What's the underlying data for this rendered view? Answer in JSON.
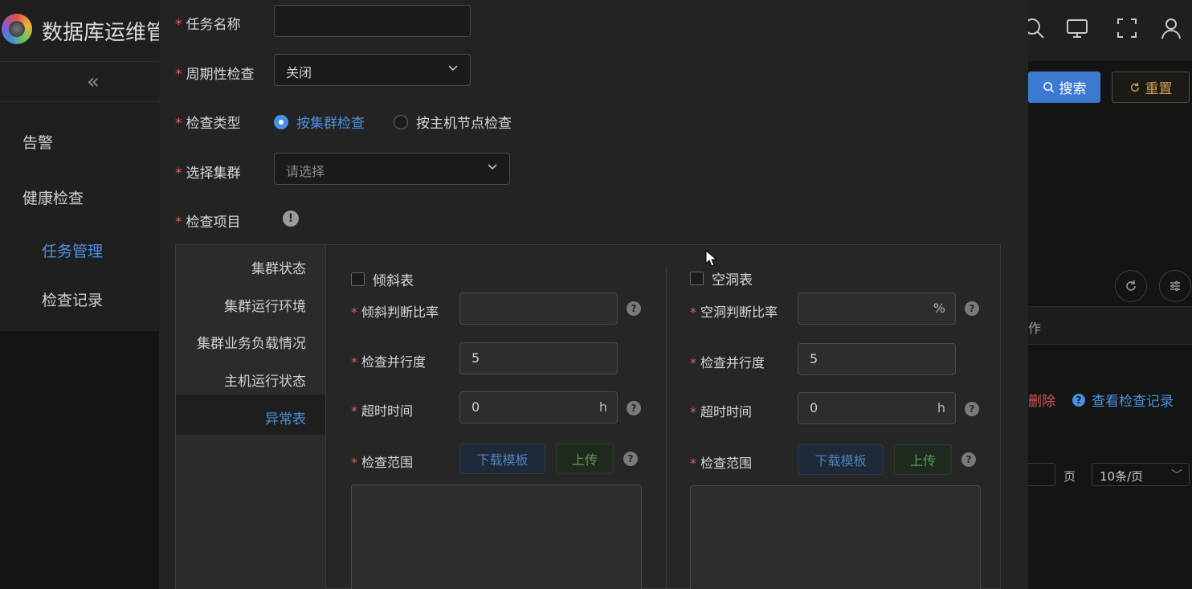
{
  "app": {
    "title": "数据库运维管",
    "icons": [
      "search-icon",
      "monitor-icon",
      "fullscreen-icon",
      "user-icon"
    ]
  },
  "sidebar": {
    "collapse_icon": "«",
    "items": [
      {
        "label": "告警"
      },
      {
        "label": "健康检查"
      },
      {
        "label": "任务管理",
        "active": true
      },
      {
        "label": "检查记录"
      }
    ]
  },
  "toolbar": {
    "search_label": "搜索",
    "reset_label": "重置"
  },
  "table": {
    "header_partial": "作",
    "row_actions": {
      "delete": "删除",
      "view": "查看检查记录"
    }
  },
  "pagination": {
    "page_unit": "页",
    "page_size": "10条/页"
  },
  "form": {
    "task_name": {
      "label": "任务名称",
      "value": ""
    },
    "periodic_check": {
      "label": "周期性检查",
      "value": "关闭"
    },
    "check_type": {
      "label": "检查类型",
      "options": [
        {
          "label": "按集群检查",
          "selected": true
        },
        {
          "label": "按主机节点检查",
          "selected": false
        }
      ]
    },
    "cluster": {
      "label": "选择集群",
      "placeholder": "请选择"
    },
    "check_items": {
      "label": "检查项目",
      "info_icon": "!"
    }
  },
  "panel": {
    "tabs": [
      {
        "label": "集群状态"
      },
      {
        "label": "集群运行环境"
      },
      {
        "label": "集群业务负载情况"
      },
      {
        "label": "主机运行状态"
      },
      {
        "label": "异常表",
        "active": true
      }
    ],
    "left": {
      "checkbox": "倾斜表",
      "ratio_label": "倾斜判断比率",
      "ratio_value": "",
      "parallel_label": "检查并行度",
      "parallel_value": "5",
      "timeout_label": "超时时间",
      "timeout_value": "0",
      "timeout_unit": "h",
      "range_label": "检查范围",
      "download_label": "下载模板",
      "upload_label": "上传"
    },
    "right": {
      "checkbox": "空洞表",
      "ratio_label": "空洞判断比率",
      "ratio_value": "",
      "ratio_unit": "%",
      "parallel_label": "检查并行度",
      "parallel_value": "5",
      "timeout_label": "超时时间",
      "timeout_value": "0",
      "timeout_unit": "h",
      "range_label": "检查范围",
      "download_label": "下载模板",
      "upload_label": "上传"
    }
  }
}
